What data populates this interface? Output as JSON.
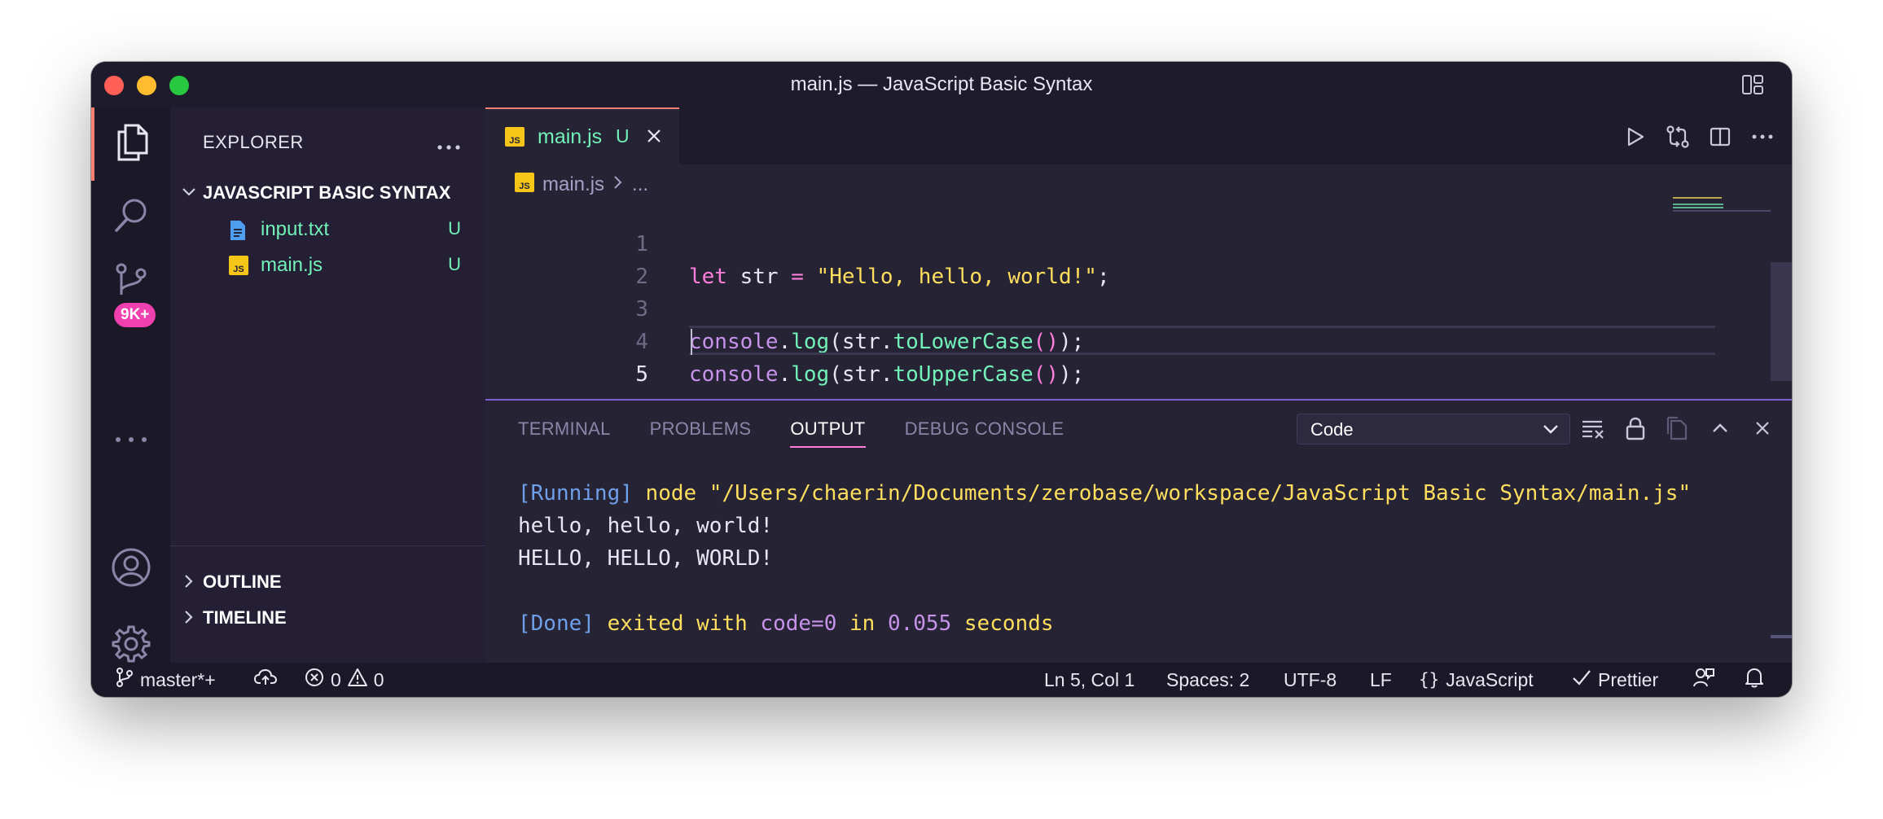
{
  "window": {
    "title": "main.js — JavaScript Basic Syntax"
  },
  "activity_bar": {
    "scm_badge": "9K+"
  },
  "sidebar": {
    "header": "EXPLORER",
    "folder": "JAVASCRIPT BASIC SYNTAX",
    "files": [
      {
        "name": "input.txt",
        "status": "U",
        "icon": "file-text-icon"
      },
      {
        "name": "main.js",
        "status": "U",
        "icon": "js-file-icon"
      }
    ],
    "sections": [
      "OUTLINE",
      "TIMELINE"
    ]
  },
  "editor": {
    "tab": {
      "name": "main.js",
      "status": "U"
    },
    "breadcrumb": {
      "file": "main.js",
      "rest": "..."
    },
    "line_numbers": [
      "1",
      "2",
      "3",
      "4",
      "5"
    ],
    "code": {
      "l1": {
        "kw": "let",
        "var": " str ",
        "op": "=",
        "str": " \"Hello, hello, world!\"",
        "end": ";"
      },
      "l3": {
        "obj": "console",
        "dot": ".",
        "fn": "log",
        "p1": "(str.",
        "m": "toLowerCase",
        "pp": "()",
        "end": ");"
      },
      "l4": {
        "obj": "console",
        "dot": ".",
        "fn": "log",
        "p1": "(str.",
        "m": "toUpperCase",
        "pp": "()",
        "end": ");"
      }
    }
  },
  "panel": {
    "tabs": [
      "TERMINAL",
      "PROBLEMS",
      "OUTPUT",
      "DEBUG CONSOLE"
    ],
    "active_tab": "OUTPUT",
    "output_channel": "Code",
    "output": {
      "running_tag": "[Running]",
      "running_cmd": " node \"/Users/chaerin/Documents/zerobase/workspace/JavaScript Basic Syntax/main.js\"",
      "line2": "hello, hello, world!",
      "line3": "HELLO, HELLO, WORLD!",
      "done_tag": "[Done]",
      "done_a": " exited with ",
      "done_code": "code=0",
      "done_b": " in ",
      "done_time": "0.055",
      "done_c": " seconds"
    }
  },
  "statusbar": {
    "branch": "master*+",
    "errors": "0",
    "warnings": "0",
    "position": "Ln 5, Col 1",
    "spaces": "Spaces: 2",
    "encoding": "UTF-8",
    "eol": "LF",
    "language": "JavaScript",
    "formatter": "Prettier"
  },
  "colors": {
    "accent": "#ff7edb",
    "string": "#fede5d",
    "git_untracked": "#72f1b8",
    "badge": "#f03fae"
  }
}
